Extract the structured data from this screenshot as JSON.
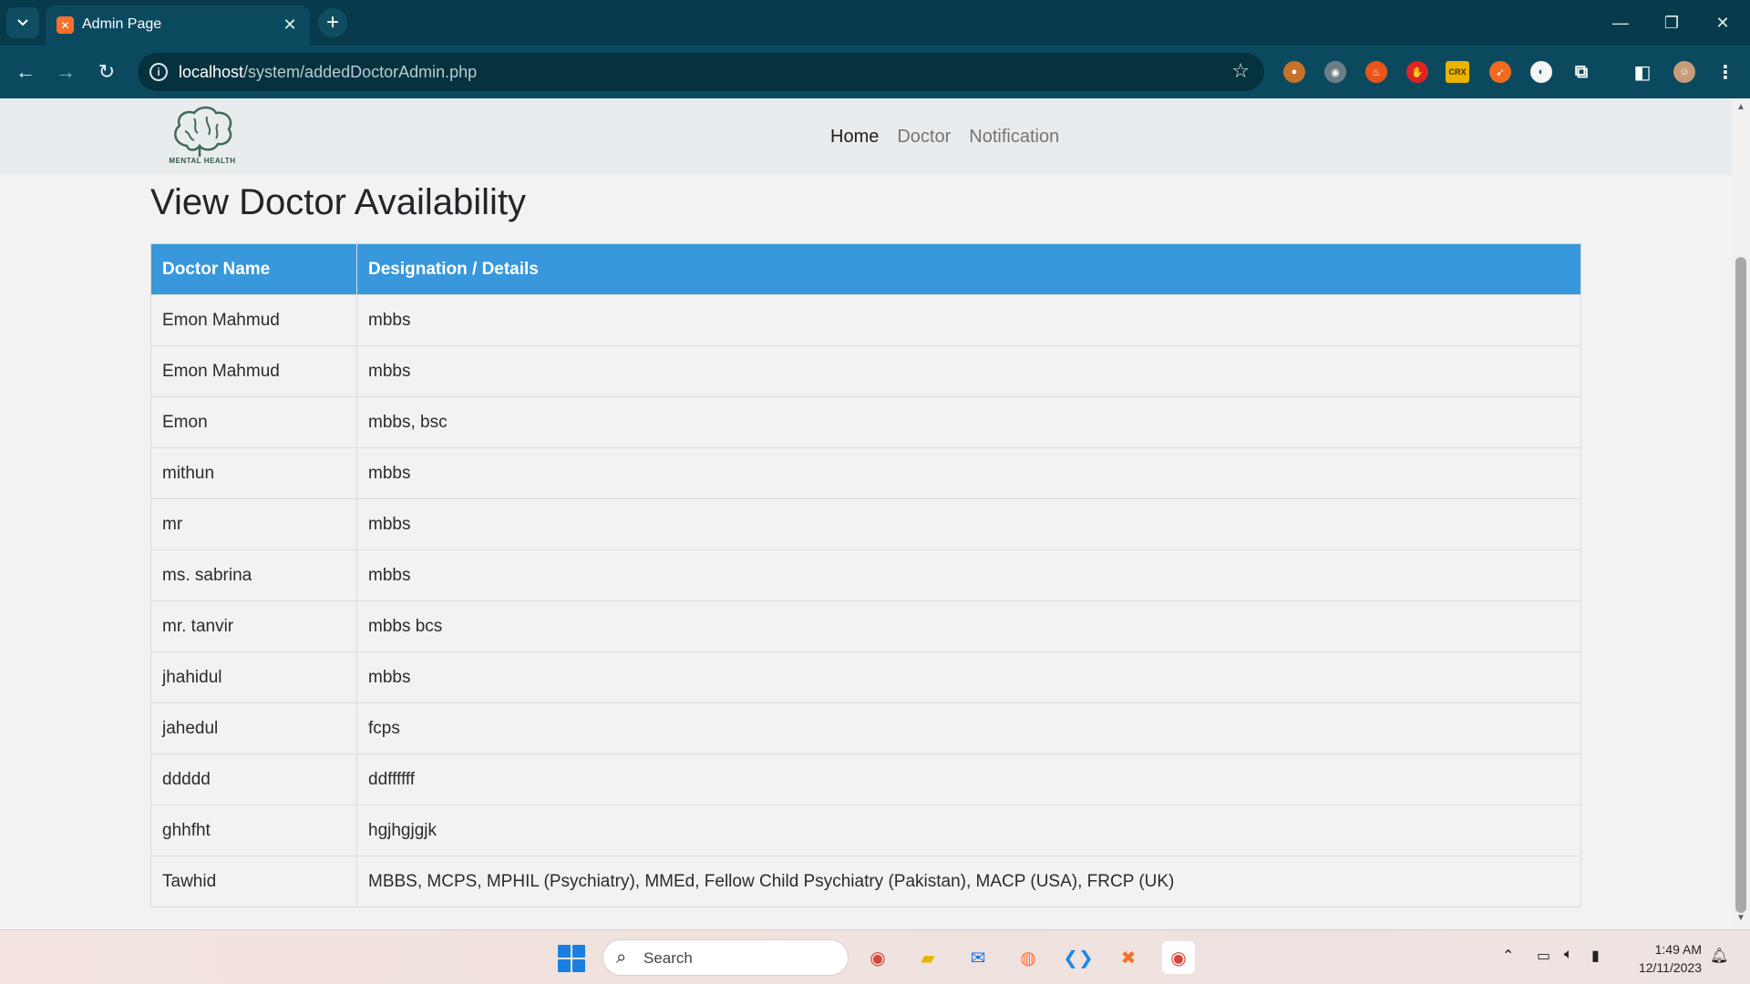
{
  "browser": {
    "tab_title": "Admin Page",
    "url_host": "localhost",
    "url_path": "/system/addedDoctorAdmin.php"
  },
  "site": {
    "logo_text": "MENTAL HEALTH",
    "nav": [
      "Home",
      "Doctor",
      "Notification"
    ]
  },
  "page": {
    "title": "View Doctor Availability"
  },
  "table": {
    "headers": [
      "Doctor Name",
      "Designation / Details"
    ],
    "rows": [
      [
        "Emon Mahmud",
        "mbbs"
      ],
      [
        "Emon Mahmud",
        "mbbs"
      ],
      [
        "Emon",
        "mbbs, bsc"
      ],
      [
        "mithun",
        "mbbs"
      ],
      [
        "mr",
        "mbbs"
      ],
      [
        "ms. sabrina",
        "mbbs"
      ],
      [
        "mr. tanvir",
        "mbbs bcs"
      ],
      [
        "jhahidul",
        "mbbs"
      ],
      [
        "jahedul",
        "fcps"
      ],
      [
        "ddddd",
        "ddffffff"
      ],
      [
        "ghhfht",
        "hgjhgjgjk"
      ],
      [
        "Tawhid",
        "MBBS, MCPS, MPHIL (Psychiatry), MMEd, Fellow Child Psychiatry (Pakistan), MACP (USA), FRCP (UK)"
      ]
    ]
  },
  "taskbar": {
    "search_placeholder": "Search",
    "time": "1:49 AM",
    "date": "12/11/2023"
  },
  "colors": {
    "header_blue": "#3898db",
    "chrome_dark": "#073a4b",
    "chrome_toolbar": "#0b4a5e"
  }
}
